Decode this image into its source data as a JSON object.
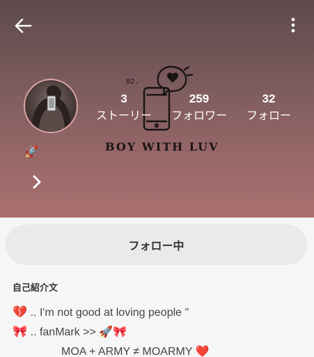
{
  "stats": [
    {
      "count": "3",
      "label": "ストーリー"
    },
    {
      "count": "259",
      "label": "フォロワー"
    },
    {
      "count": "32",
      "label": "フォロー"
    }
  ],
  "cover_text": "BOY WITH LUV",
  "cover_small_text": "02.",
  "rocket_emoji": "🚀",
  "follow_button_label": "フォロー中",
  "bio": {
    "heading": "自己紹介文",
    "lines": [
      {
        "emoji": "💔",
        "text": " ..  I'm not good at loving people \""
      },
      {
        "emoji": "🎀",
        "text": " .. fanMark >> 🚀🎀"
      },
      {
        "emoji": "",
        "text": "MOA + ARMY ≠ MOARMY ❤️"
      }
    ]
  },
  "colors": {
    "header_top": "#5e4a4c",
    "header_bottom": "#aa7170",
    "button_bg": "#e8eaeb",
    "text_dark": "#333333"
  }
}
